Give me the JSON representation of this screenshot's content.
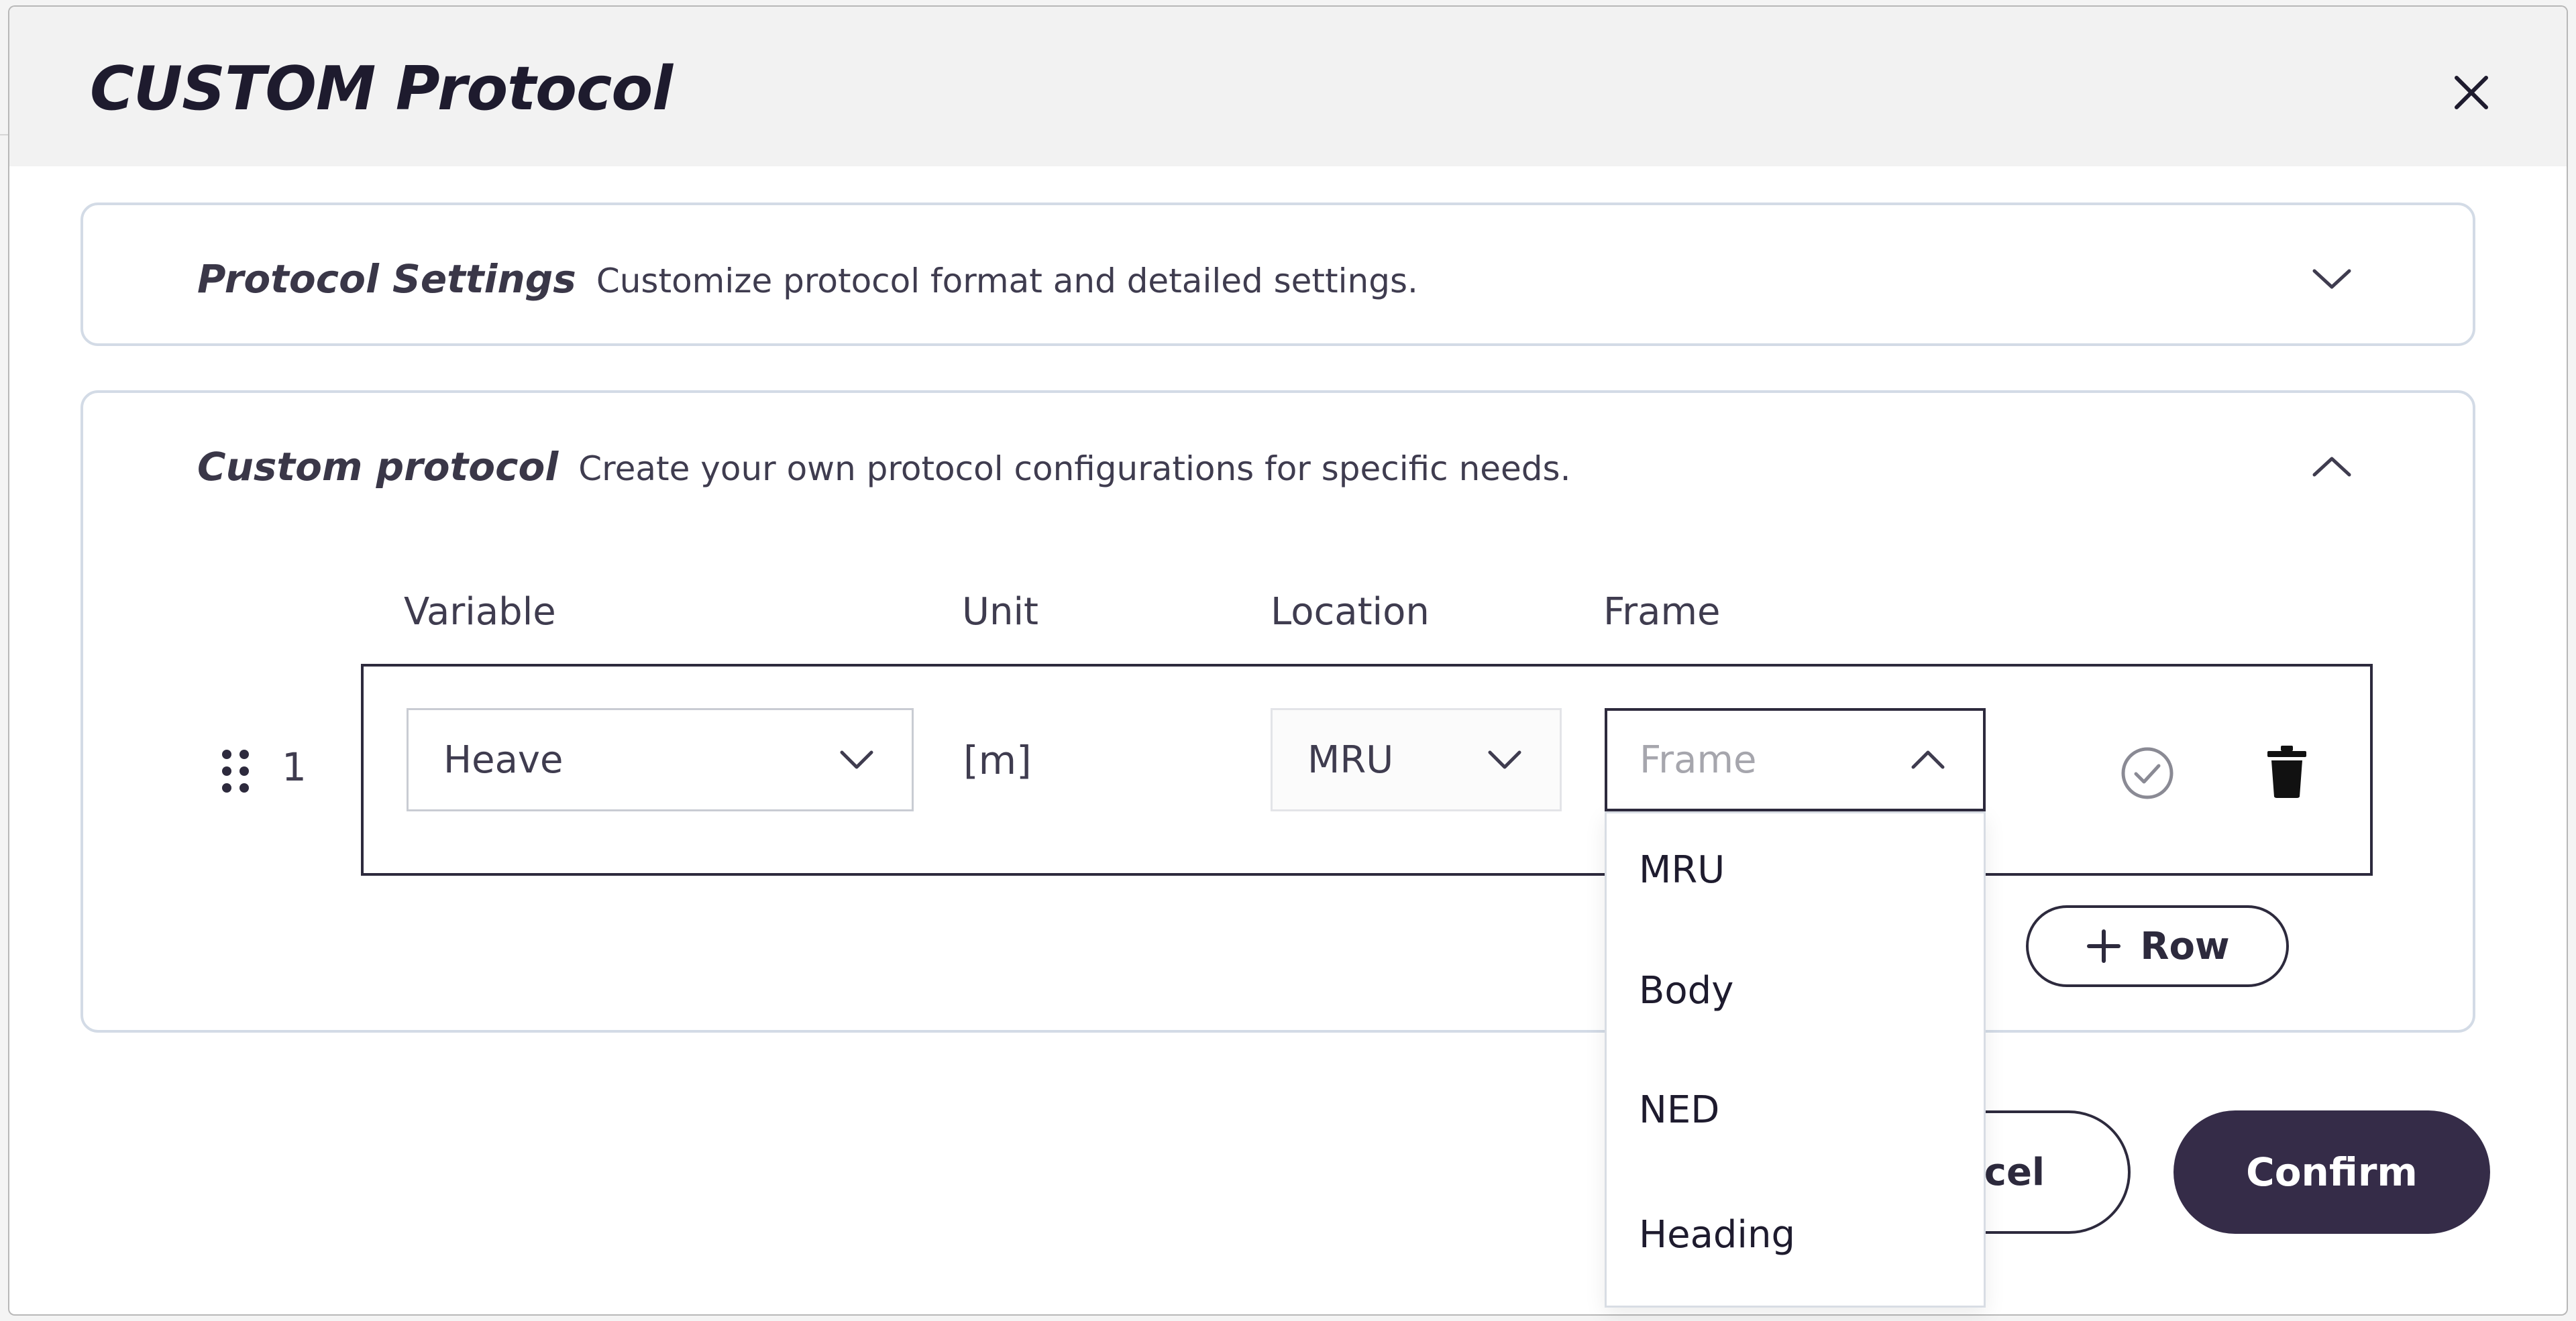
{
  "modal": {
    "title": "CUSTOM Protocol"
  },
  "sections": {
    "settings": {
      "title": "Protocol Settings",
      "description": "Customize protocol format and detailed settings."
    },
    "custom": {
      "title": "Custom protocol",
      "description": "Create your own protocol configurations for specific needs."
    }
  },
  "table": {
    "columns": [
      "Variable",
      "Unit",
      "Location",
      "Frame"
    ],
    "rows": [
      {
        "index": "1",
        "variable": "Heave",
        "unit": "[m]",
        "location": "MRU",
        "frame_placeholder": "Frame"
      }
    ]
  },
  "frame_dropdown": {
    "options": [
      "MRU",
      "Body",
      "NED",
      "Heading"
    ]
  },
  "buttons": {
    "add_row": "Row",
    "cancel": "ncel",
    "confirm": "Confirm"
  },
  "colors": {
    "primary": "#352c48",
    "border": "#d3dbe6",
    "header_bg": "#f2f2f2"
  }
}
